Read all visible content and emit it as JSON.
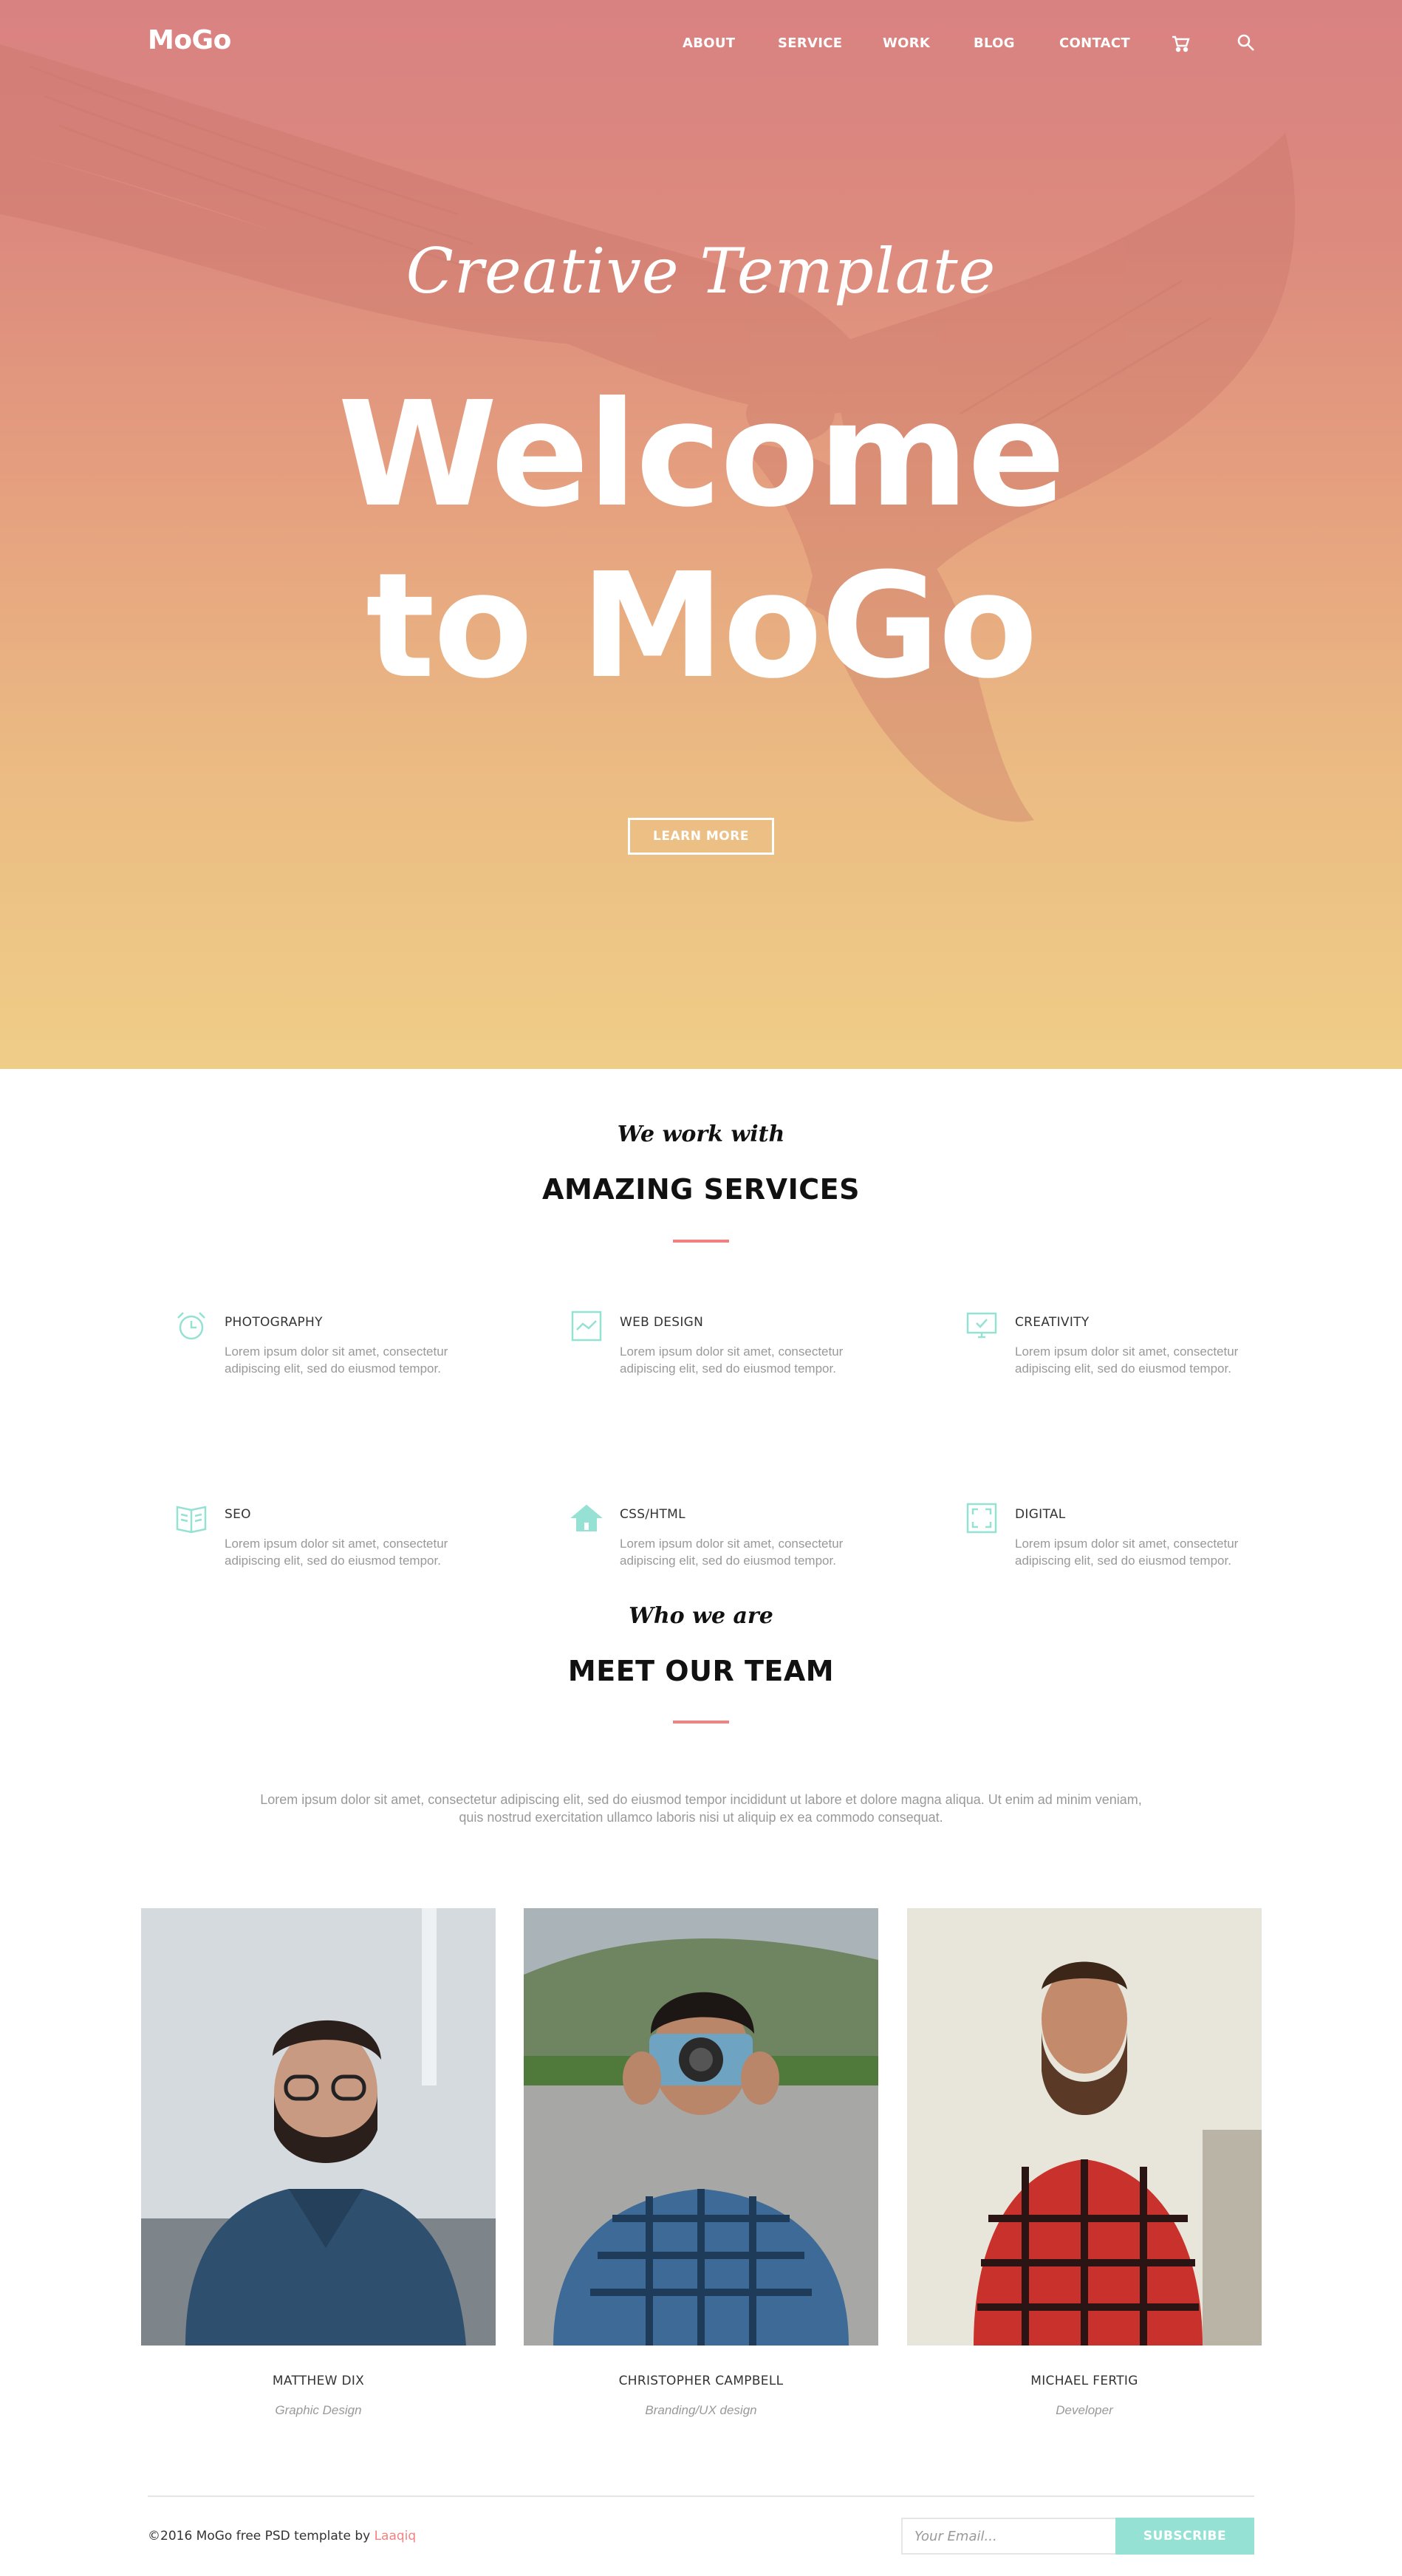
{
  "brand": {
    "logo": "MoGo"
  },
  "nav": {
    "items": [
      "ABOUT",
      "SERVICE",
      "WORK",
      "BLOG",
      "CONTACT"
    ],
    "icons": [
      "cart-icon",
      "search-icon"
    ]
  },
  "hero": {
    "subtitle": "Creative Template",
    "title_line1": "Welcome",
    "title_line2": "to MoGo",
    "button": "LEARN MORE"
  },
  "services": {
    "kicker": "We work with",
    "heading": "AMAZING SERVICES",
    "items": [
      {
        "title": "PHOTOGRAPHY",
        "text": "Lorem ipsum dolor sit amet, consectetur adipiscing elit, sed do eiusmod tempor.",
        "icon": "alarm-clock-icon"
      },
      {
        "title": "WEB DESIGN",
        "text": "Lorem ipsum dolor sit amet, consectetur adipiscing elit, sed do eiusmod tempor.",
        "icon": "line-chart-icon"
      },
      {
        "title": "CREATIVITY",
        "text": "Lorem ipsum dolor sit amet, consectetur adipiscing elit, sed do eiusmod tempor.",
        "icon": "monitor-check-icon"
      },
      {
        "title": "SEO",
        "text": "Lorem ipsum dolor sit amet, consectetur adipiscing elit, sed do eiusmod tempor.",
        "icon": "open-book-icon"
      },
      {
        "title": "CSS/HTML",
        "text": "Lorem ipsum dolor sit amet, consectetur adipiscing elit, sed do eiusmod tempor.",
        "icon": "house-icon"
      },
      {
        "title": "DIGITAL",
        "text": "Lorem ipsum dolor sit amet, consectetur adipiscing elit, sed do eiusmod tempor.",
        "icon": "fullscreen-frame-icon"
      }
    ]
  },
  "team": {
    "kicker": "Who we are",
    "heading": "MEET OUR TEAM",
    "intro": "Lorem ipsum dolor sit amet, consectetur adipiscing elit, sed do eiusmod tempor incididunt ut labore et dolore magna aliqua. Ut enim ad minim veniam, quis nostrud exercitation ullamco laboris nisi ut aliquip ex ea commodo consequat.",
    "members": [
      {
        "name": "MATTHEW DIX",
        "role": "Graphic Design"
      },
      {
        "name": "CHRISTOPHER CAMPBELL",
        "role": "Branding/UX design"
      },
      {
        "name": "MICHAEL FERTIG",
        "role": "Developer"
      }
    ]
  },
  "footer": {
    "copyright_prefix": "©2016 MoGo free PSD template by ",
    "copyright_link": "Laaqiq",
    "email_placeholder": "Your Email...",
    "subscribe": "SUBSCRIBE"
  },
  "colors": {
    "accent_red": "#f38181",
    "accent_teal": "#95e1d3",
    "hero_top": "#d98282",
    "hero_bottom": "#efcd87"
  }
}
